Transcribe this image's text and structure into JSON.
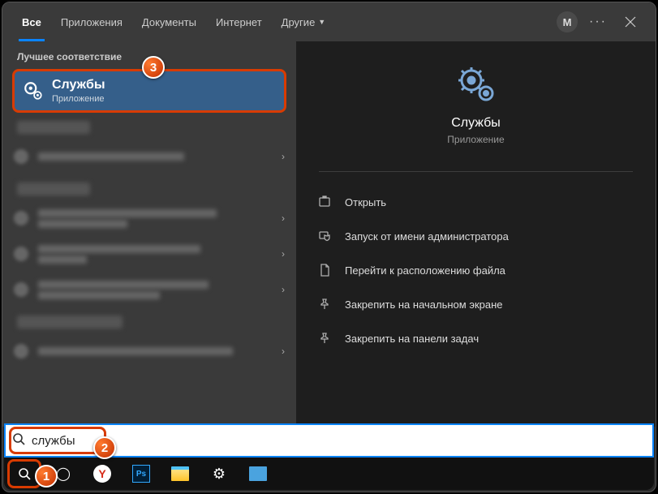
{
  "tabs": {
    "all": "Все",
    "apps": "Приложения",
    "docs": "Документы",
    "web": "Интернет",
    "more": "Другие"
  },
  "user_initial": "M",
  "left": {
    "best_match_header": "Лучшее соответствие",
    "best": {
      "title": "Службы",
      "subtitle": "Приложение"
    }
  },
  "right": {
    "title": "Службы",
    "subtitle": "Приложение",
    "actions": {
      "open": "Открыть",
      "admin": "Запуск от имени администратора",
      "location": "Перейти к расположению файла",
      "pin_start": "Закрепить на начальном экране",
      "pin_taskbar": "Закрепить на панели задач"
    }
  },
  "search": {
    "value": "службы"
  },
  "badges": {
    "b1": "1",
    "b2": "2",
    "b3": "3"
  }
}
